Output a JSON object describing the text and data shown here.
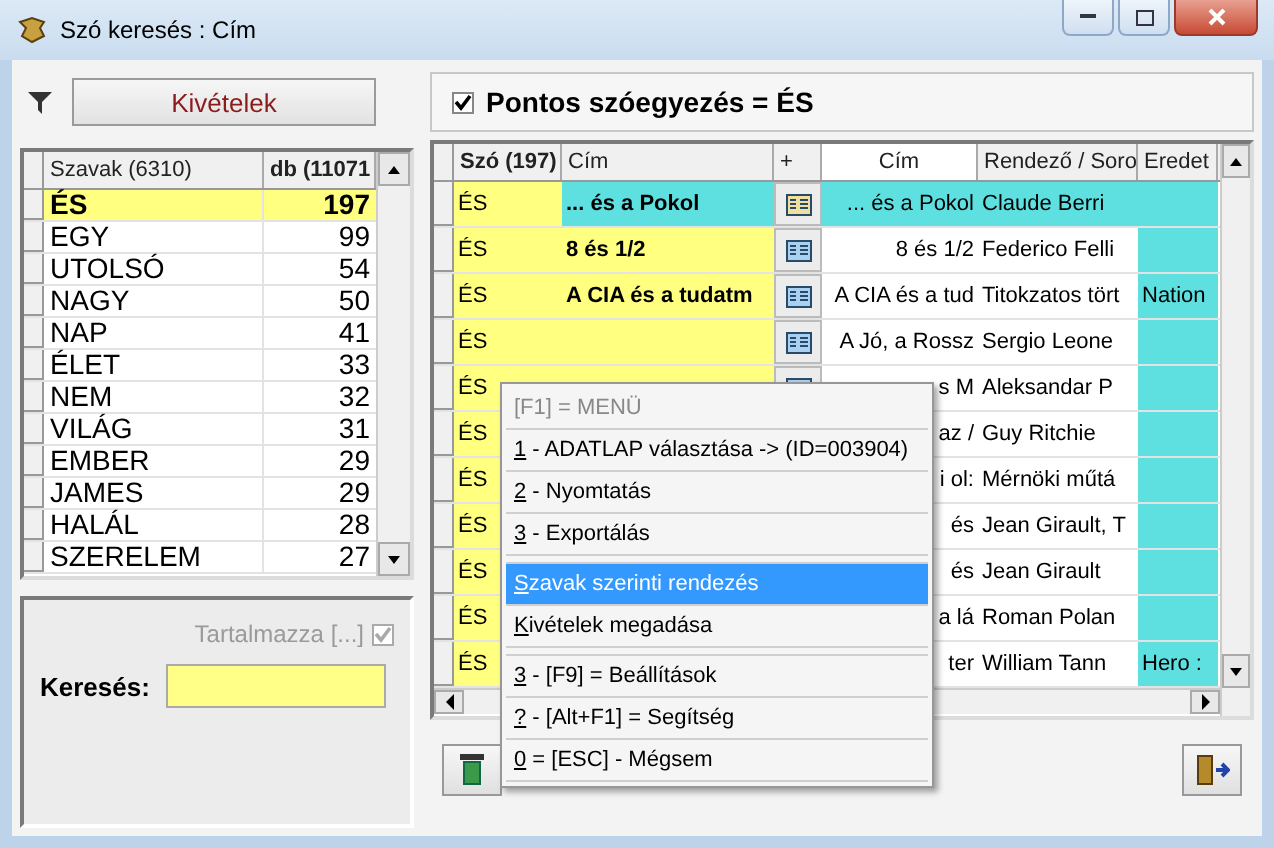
{
  "window": {
    "title": "Szó keresés : Cím"
  },
  "left": {
    "exceptions_button": "Kivételek",
    "columns": [
      "Szavak (6310)",
      "db (11071"
    ],
    "rows": [
      {
        "word": "ÉS",
        "count": "197",
        "selected": true
      },
      {
        "word": "EGY",
        "count": "99",
        "selected": false
      },
      {
        "word": "UTOLSÓ",
        "count": "54",
        "selected": false
      },
      {
        "word": "NAGY",
        "count": "50",
        "selected": false
      },
      {
        "word": "NAP",
        "count": "41",
        "selected": false
      },
      {
        "word": "ÉLET",
        "count": "33",
        "selected": false
      },
      {
        "word": "NEM",
        "count": "32",
        "selected": false
      },
      {
        "word": "VILÁG",
        "count": "31",
        "selected": false
      },
      {
        "word": "EMBER",
        "count": "29",
        "selected": false
      },
      {
        "word": "JAMES",
        "count": "29",
        "selected": false
      },
      {
        "word": "HALÁL",
        "count": "28",
        "selected": false
      },
      {
        "word": "SZERELEM",
        "count": "27",
        "selected": false
      }
    ],
    "contains": {
      "label": "Tartalmazza [...]",
      "checked": true,
      "disabled": true
    },
    "search": {
      "label": "Keresés:"
    }
  },
  "right": {
    "exact_match": {
      "label": "Pontos szóegyezés = ÉS",
      "checked": true
    },
    "columns": [
      "Szó (197)",
      "Cím",
      "+",
      "Cím",
      "Rendező / Soro",
      "Eredet"
    ],
    "rows": [
      {
        "word": "ÉS",
        "title": "... és a Pokol",
        "title2": "... és a Pokol",
        "director": "Claude Berri",
        "origin": "",
        "selected": true
      },
      {
        "word": "ÉS",
        "title": "8 és 1/2",
        "title2": "8 és 1/2",
        "director": "Federico Felli",
        "origin": "",
        "selected": false
      },
      {
        "word": "ÉS",
        "title": "A CIA és a tudatm",
        "title2": "A CIA és a tud",
        "director": "Titokzatos tört",
        "origin": "Nation",
        "selected": false
      },
      {
        "word": "ÉS",
        "title": "",
        "title2": "A Jó, a Rossz",
        "director": "Sergio Leone",
        "origin": "",
        "selected": false
      },
      {
        "word": "ÉS",
        "title": "",
        "title2": "s M",
        "director": "Aleksandar P",
        "origin": "",
        "selected": false
      },
      {
        "word": "ÉS",
        "title": "",
        "title2": "az /",
        "director": "Guy Ritchie",
        "origin": "",
        "selected": false
      },
      {
        "word": "ÉS",
        "title": "",
        "title2": "i ol:",
        "director": "Mérnöki műtá",
        "origin": "",
        "selected": false
      },
      {
        "word": "ÉS",
        "title": "",
        "title2": "és",
        "director": "Jean Girault, T",
        "origin": "",
        "selected": false
      },
      {
        "word": "ÉS",
        "title": "",
        "title2": "és",
        "director": "Jean Girault",
        "origin": "",
        "selected": false
      },
      {
        "word": "ÉS",
        "title": "",
        "title2": "a lá",
        "director": "Roman Polan",
        "origin": "",
        "selected": false
      },
      {
        "word": "ÉS",
        "title": "",
        "title2": "ter",
        "director": "William Tann",
        "origin": "Hero :",
        "selected": false
      }
    ]
  },
  "context_menu": {
    "items": [
      {
        "kind": "header",
        "label": "[F1] = MENÜ",
        "selected": false
      },
      {
        "kind": "item",
        "label": "1 - ADATLAP választása -> (ID=003904)",
        "selected": false
      },
      {
        "kind": "item",
        "label": "2 - Nyomtatás",
        "selected": false
      },
      {
        "kind": "item",
        "label": "3 - Exportálás",
        "selected": false
      },
      {
        "kind": "separator",
        "selected": false
      },
      {
        "kind": "item",
        "label": "Szavak szerinti rendezés",
        "selected": true
      },
      {
        "kind": "item",
        "label": "Kivételek megadása",
        "selected": false
      },
      {
        "kind": "separator",
        "selected": false
      },
      {
        "kind": "item",
        "label": "3 - [F9] = Beállítások",
        "selected": false
      },
      {
        "kind": "item",
        "label": "? - [Alt+F1] = Segítség",
        "selected": false
      },
      {
        "kind": "item",
        "label": "0 = [ESC] - Mégsem",
        "selected": false
      }
    ]
  }
}
